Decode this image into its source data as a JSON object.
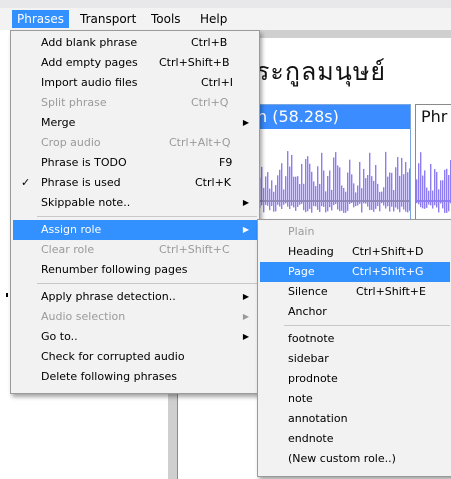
{
  "menubar": {
    "items": [
      "Phrases",
      "Transport",
      "Tools",
      "Help"
    ]
  },
  "document": {
    "thai_heading": "ระกูลมนุษย์",
    "phrase1_header": "n (58.28s)",
    "phrase2_header": "Phr"
  },
  "phrases_menu": {
    "items": [
      {
        "label": "Add blank phrase",
        "shortcut": "Ctrl+B"
      },
      {
        "label": "Add empty pages",
        "shortcut": "Ctrl+Shift+B"
      },
      {
        "label": "Import audio files",
        "shortcut": "Ctrl+I"
      },
      {
        "label": "Split phrase",
        "shortcut": "Ctrl+Q"
      },
      {
        "label": "Merge",
        "shortcut": ""
      },
      {
        "label": "Crop audio",
        "shortcut": "Ctrl+Alt+Q"
      },
      {
        "label": "Phrase is TODO",
        "shortcut": "F9"
      },
      {
        "label": "Phrase is used",
        "shortcut": "Ctrl+K"
      },
      {
        "label": "Skippable note..",
        "shortcut": ""
      },
      {
        "label": "Assign role",
        "shortcut": ""
      },
      {
        "label": "Clear role",
        "shortcut": "Ctrl+Shift+C"
      },
      {
        "label": "Renumber following pages",
        "shortcut": ""
      },
      {
        "label": "Apply phrase detection..",
        "shortcut": ""
      },
      {
        "label": "Audio selection",
        "shortcut": ""
      },
      {
        "label": "Go to..",
        "shortcut": ""
      },
      {
        "label": "Check for corrupted audio",
        "shortcut": ""
      },
      {
        "label": "Delete following phrases",
        "shortcut": ""
      }
    ]
  },
  "role_submenu": {
    "items": [
      {
        "label": "Plain",
        "shortcut": ""
      },
      {
        "label": "Heading",
        "shortcut": "Ctrl+Shift+D"
      },
      {
        "label": "Page",
        "shortcut": "Ctrl+Shift+G"
      },
      {
        "label": "Silence",
        "shortcut": "Ctrl+Shift+E"
      },
      {
        "label": "Anchor",
        "shortcut": ""
      },
      {
        "label": "footnote",
        "shortcut": ""
      },
      {
        "label": "sidebar",
        "shortcut": ""
      },
      {
        "label": "prodnote",
        "shortcut": ""
      },
      {
        "label": "note",
        "shortcut": ""
      },
      {
        "label": "annotation",
        "shortcut": ""
      },
      {
        "label": "endnote",
        "shortcut": ""
      },
      {
        "label": "(New custom role..)",
        "shortcut": ""
      }
    ]
  },
  "icons": {
    "check": "check-icon",
    "submenu_arrow": "chevron-right-icon"
  },
  "colors": {
    "highlight": "#3390ff",
    "waveform": "#8e7df0",
    "phrase_header": "#3a8cff"
  }
}
